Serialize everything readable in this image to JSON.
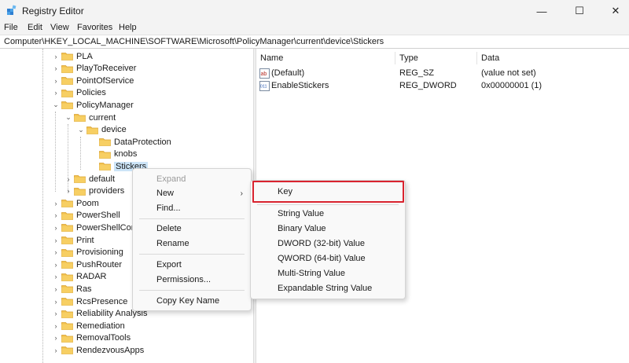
{
  "window": {
    "title": "Registry Editor",
    "min_glyph": "—",
    "max_glyph": "☐",
    "close_glyph": "✕"
  },
  "menu": [
    "File",
    "Edit",
    "View",
    "Favorites",
    "Help"
  ],
  "address": "Computer\\HKEY_LOCAL_MACHINE\\SOFTWARE\\Microsoft\\PolicyManager\\current\\device\\Stickers",
  "tree": [
    {
      "label": "PLA",
      "caret": "›"
    },
    {
      "label": "PlayToReceiver",
      "caret": "›"
    },
    {
      "label": "PointOfService",
      "caret": "›"
    },
    {
      "label": "Policies",
      "caret": "›"
    },
    {
      "label": "PolicyManager",
      "caret": "⌄"
    },
    {
      "label": "current",
      "caret": "⌄"
    },
    {
      "label": "device",
      "caret": "⌄"
    },
    {
      "label": "DataProtection",
      "caret": ""
    },
    {
      "label": "knobs",
      "caret": ""
    },
    {
      "label": "Stickers",
      "caret": ""
    },
    {
      "label": "default",
      "caret": "›"
    },
    {
      "label": "providers",
      "caret": "›"
    },
    {
      "label": "Poom",
      "caret": "›"
    },
    {
      "label": "PowerShell",
      "caret": "›"
    },
    {
      "label": "PowerShellCore",
      "caret": "›"
    },
    {
      "label": "Print",
      "caret": "›"
    },
    {
      "label": "Provisioning",
      "caret": "›"
    },
    {
      "label": "PushRouter",
      "caret": "›"
    },
    {
      "label": "RADAR",
      "caret": "›"
    },
    {
      "label": "Ras",
      "caret": "›"
    },
    {
      "label": "RcsPresence",
      "caret": "›"
    },
    {
      "label": "Reliability Analysis",
      "caret": "›"
    },
    {
      "label": "Remediation",
      "caret": "›"
    },
    {
      "label": "RemovalTools",
      "caret": "›"
    },
    {
      "label": "RendezvousApps",
      "caret": "›"
    }
  ],
  "columns": {
    "name": "Name",
    "type": "Type",
    "data": "Data"
  },
  "values": [
    {
      "icon": "string-value-icon",
      "icon_text": "ab",
      "name": "(Default)",
      "type": "REG_SZ",
      "data": "(value not set)"
    },
    {
      "icon": "binary-value-icon",
      "icon_text": "011",
      "name": "EnableStickers",
      "type": "REG_DWORD",
      "data": "0x00000001 (1)"
    }
  ],
  "context_menu": {
    "expand": "Expand",
    "new": "New",
    "new_arrow": "›",
    "find": "Find...",
    "delete": "Delete",
    "rename": "Rename",
    "export": "Export",
    "permissions": "Permissions...",
    "copy_key_name": "Copy Key Name"
  },
  "new_submenu": {
    "key": "Key",
    "string_value": "String Value",
    "binary_value": "Binary Value",
    "dword_value": "DWORD (32-bit) Value",
    "qword_value": "QWORD (64-bit) Value",
    "multi_string_value": "Multi-String Value",
    "expandable_string_value": "Expandable String Value"
  },
  "colors": {
    "highlight": "#d9232f",
    "folder": "#f2c14e",
    "selection": "#cce4f7"
  }
}
